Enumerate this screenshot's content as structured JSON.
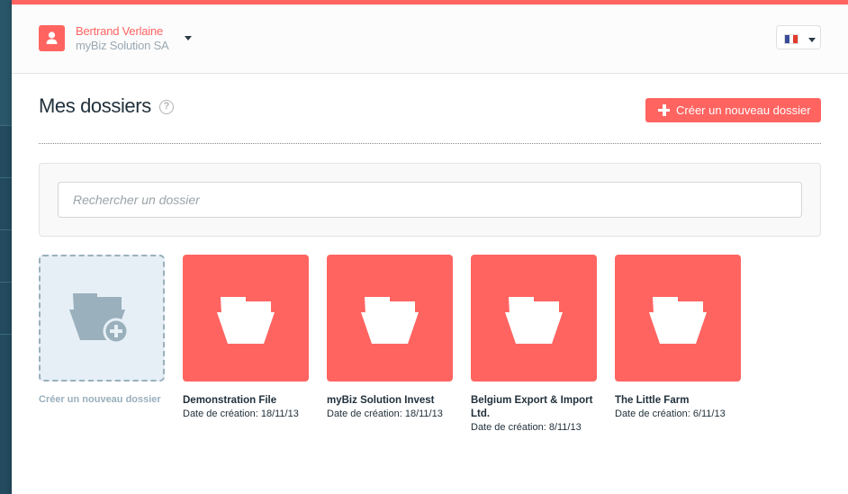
{
  "header": {
    "user_name": "Bertrand Verlaine",
    "company": "myBiz Solution SA",
    "language": "fr",
    "flag_colors": [
      "#3a4c97",
      "#ffffff",
      "#e23b2c"
    ]
  },
  "page": {
    "title": "Mes dossiers",
    "help_glyph": "?",
    "create_button_label": "Créer un nouveau dossier"
  },
  "search": {
    "placeholder": "Rechercher un dossier",
    "value": ""
  },
  "new_folder_tile": {
    "label": "Créer un nouveau dossier"
  },
  "folders": [
    {
      "name": "Demonstration File",
      "date": "Date de création: 18/11/13"
    },
    {
      "name": "myBiz Solution Invest",
      "date": "Date de création: 18/11/13"
    },
    {
      "name": "Belgium Export & Import Ltd.",
      "date": "Date de création: 8/11/13"
    },
    {
      "name": "The Little Farm",
      "date": "Date de création: 6/11/13"
    }
  ],
  "colors": {
    "accent": "#ff6461",
    "sidebar": "#234a5e",
    "muted": "#9aafbc",
    "text": "#22313c"
  }
}
